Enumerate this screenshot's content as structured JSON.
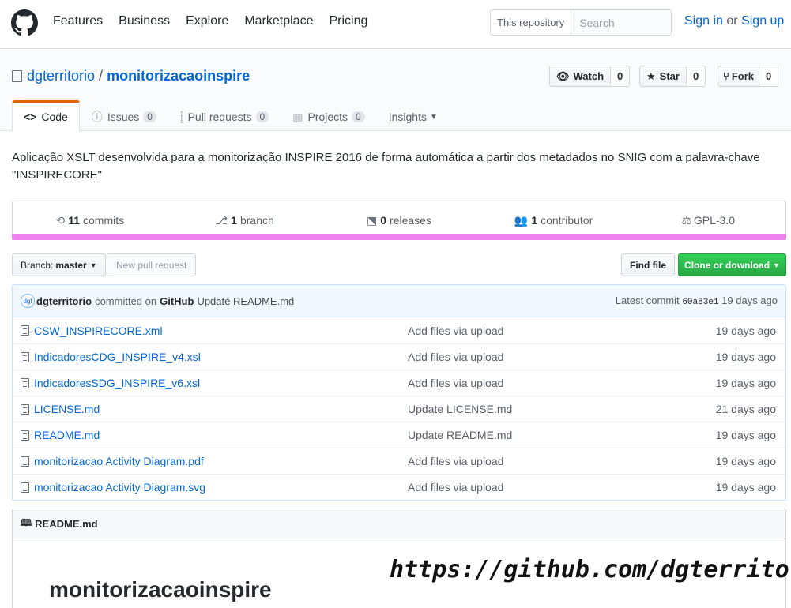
{
  "header": {
    "nav": [
      "Features",
      "Business",
      "Explore",
      "Marketplace",
      "Pricing"
    ],
    "search_scope": "This repository",
    "search_placeholder": "Search",
    "sign_in": "Sign in",
    "or": "or",
    "sign_up": "Sign up"
  },
  "repo": {
    "owner": "dgterritorio",
    "separator": "/",
    "name": "monitorizacaoinspire",
    "watch_label": "Watch",
    "watch_count": "0",
    "star_label": "Star",
    "star_count": "0",
    "fork_label": "Fork",
    "fork_count": "0"
  },
  "tabs": [
    {
      "label": "Code",
      "icon": "<>"
    },
    {
      "label": "Issues",
      "count": "0"
    },
    {
      "label": "Pull requests",
      "count": "0"
    },
    {
      "label": "Projects",
      "count": "0"
    },
    {
      "label": "Insights"
    }
  ],
  "description": "Aplicação XSLT desenvolvida para a monitorização INSPIRE 2016 de forma automática a partir dos metadados no SNIG com a palavra-chave \"INSPIRECORE\"",
  "summary": {
    "commits_count": "11",
    "commits_label": "commits",
    "branch_count": "1",
    "branch_label": "branch",
    "releases_count": "0",
    "releases_label": "releases",
    "contributor_count": "1",
    "contributor_label": "contributor",
    "license": "GPL-3.0"
  },
  "language_color": "#ee82ee",
  "filenav": {
    "branch_prefix": "Branch:",
    "branch_name": "master",
    "new_pr": "New pull request",
    "find_file": "Find file",
    "clone": "Clone or download"
  },
  "commit": {
    "avatar_text": "dgt",
    "author": "dgterritorio",
    "committed_on": "committed on",
    "via": "GitHub",
    "message": "Update README.md",
    "latest_label": "Latest commit",
    "sha": "60a83e1",
    "age": "19 days ago"
  },
  "files": [
    {
      "name": "CSW_INSPIRECORE.xml",
      "message": "Add files via upload",
      "age": "19 days ago"
    },
    {
      "name": "IndicadoresCDG_INSPIRE_v4.xsl",
      "message": "Add files via upload",
      "age": "19 days ago"
    },
    {
      "name": "IndicadoresSDG_INSPIRE_v6.xsl",
      "message": "Add files via upload",
      "age": "19 days ago"
    },
    {
      "name": "LICENSE.md",
      "message": "Update LICENSE.md",
      "age": "21 days ago"
    },
    {
      "name": "README.md",
      "message": "Update README.md",
      "age": "19 days ago"
    },
    {
      "name": "monitorizacao Activity Diagram.pdf",
      "message": "Add files via upload",
      "age": "19 days ago"
    },
    {
      "name": "monitorizacao Activity Diagram.svg",
      "message": "Add files via upload",
      "age": "19 days ago"
    }
  ],
  "readme": {
    "filename": "README.md",
    "heading": "monitorizacaoinspire"
  },
  "watermark": "https://github.com/dgterrito"
}
